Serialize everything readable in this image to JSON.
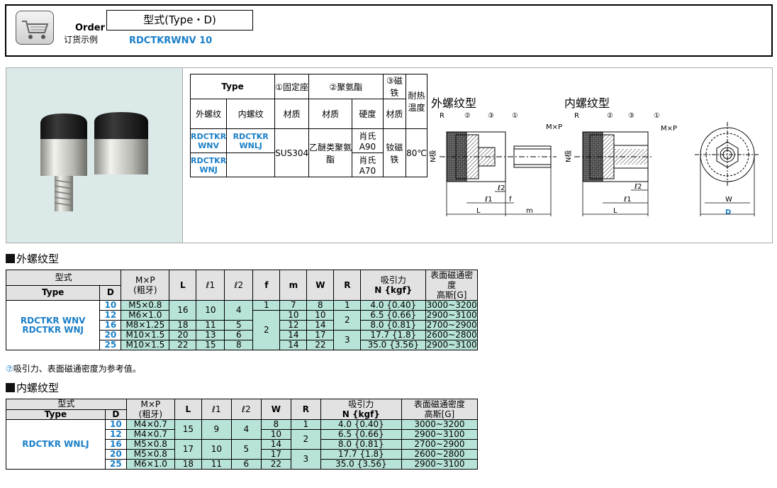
{
  "order": {
    "label_en": "Order",
    "label_cn": "订货示例",
    "type_label": "型式(Type・D)",
    "code": "RDCTKRWNV 10"
  },
  "spec": {
    "h_type": "Type",
    "h_seat": "①固定座",
    "h_pu": "②聚氨酯",
    "h_mag": "③磁铁",
    "h_heat": "耐热温度",
    "h_ext": "外螺纹",
    "h_int": "内螺纹",
    "h_mat1": "材质",
    "h_mat2": "材质",
    "h_hard": "硬度",
    "h_mat3": "材质",
    "t_wnv": "RDCTKR WNV",
    "t_wnlj": "RDCTKR WNLJ",
    "t_wnj": "RDCTKR WNJ",
    "seat_mat": "SUS304",
    "pu_mat": "乙醚类聚氨酯",
    "hard1": "肖氏A90",
    "hard2": "肖氏A70",
    "mag_mat": "钕磁铁",
    "temp": "80℃"
  },
  "diagram": {
    "ext_title": "外螺纹型",
    "int_title": "内螺纹型",
    "labels": [
      "R",
      "②",
      "③",
      "①",
      "M×P",
      "N极",
      "ℓ2",
      "ℓ1",
      "f",
      "L",
      "m",
      "W",
      "D"
    ]
  },
  "ext": {
    "title": "外螺纹型",
    "head": {
      "type_cn": "型式",
      "type": "Type",
      "d": "D",
      "mp": "M×P",
      "mp2": "(粗牙)",
      "L": "L",
      "l1": "ℓ1",
      "l2": "ℓ2",
      "f": "f",
      "m": "m",
      "W": "W",
      "R": "R",
      "pull": "吸引力",
      "pull2": "N {kgf}",
      "flux": "表面磁通密度",
      "flux2": "高斯[G]"
    },
    "types": "RDCTKR WNV RDCTKR WNJ",
    "rows": [
      {
        "d": "10",
        "mp": "M5×0.8",
        "L": "16",
        "l1": "10",
        "l2": "4",
        "f": "1",
        "m": "7",
        "W": "8",
        "R": "1",
        "pull": "4.0 {0.40}",
        "flux": "3000~3200"
      },
      {
        "d": "12",
        "mp": "M6×1.0",
        "m": "10",
        "W": "10",
        "R": "2",
        "pull": "6.5 {0.66}",
        "flux": "2900~3100"
      },
      {
        "d": "16",
        "mp": "M8×1.25",
        "L": "18",
        "l1": "11",
        "l2": "5",
        "f": "2",
        "m": "12",
        "W": "14",
        "pull": "8.0 {0.81}",
        "flux": "2700~2900"
      },
      {
        "d": "20",
        "mp": "M10×1.5",
        "L": "20",
        "l1": "13",
        "l2": "6",
        "m": "14",
        "W": "17",
        "R": "3",
        "pull": "17.7 {1.8}",
        "flux": "2600~2800"
      },
      {
        "d": "25",
        "mp": "M10×1.5",
        "L": "22",
        "l1": "15",
        "l2": "8",
        "m": "14",
        "W": "22",
        "pull": "35.0 {3.56}",
        "flux": "2900~3100"
      }
    ]
  },
  "note": "吸引力、表面磁通密度为参考值。",
  "int": {
    "title": "内螺纹型",
    "types": "RDCTKR WNLJ",
    "rows": [
      {
        "d": "10",
        "mp": "M4×0.7",
        "L": "15",
        "l1": "9",
        "l2": "4",
        "W": "8",
        "R": "1",
        "pull": "4.0 {0.40}",
        "flux": "3000~3200"
      },
      {
        "d": "12",
        "mp": "M4×0.7",
        "W": "10",
        "R": "2",
        "pull": "6.5 {0.66}",
        "flux": "2900~3100"
      },
      {
        "d": "16",
        "mp": "M5×0.8",
        "L": "17",
        "l1": "10",
        "l2": "5",
        "W": "14",
        "pull": "8.0 {0.81}",
        "flux": "2700~2900"
      },
      {
        "d": "20",
        "mp": "M5×0.8",
        "W": "17",
        "R": "3",
        "pull": "17.7 {1.8}",
        "flux": "2600~2800"
      },
      {
        "d": "25",
        "mp": "M6×1.0",
        "L": "18",
        "l1": "11",
        "l2": "6",
        "W": "22",
        "pull": "35.0 {3.56}",
        "flux": "2900~3100"
      }
    ]
  }
}
